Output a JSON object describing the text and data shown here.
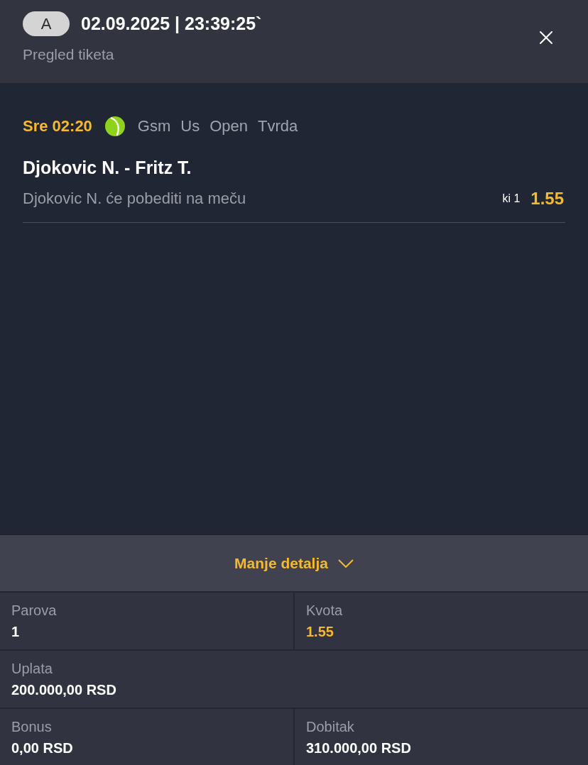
{
  "header": {
    "badge": "A",
    "datetime": "02.09.2025 | 23:39:25`",
    "subtitle": "Pregled tiketa"
  },
  "events": [
    {
      "time": "Sre 02:20",
      "kind": "tennis",
      "tags": [
        "Gsm",
        "Us",
        "Open",
        "Tvrda"
      ],
      "match": "Djokovic N. - Fritz T.",
      "selection": "Djokovic N. će pobediti na meču",
      "market": "ki 1",
      "odds": "1.55"
    }
  ],
  "details": {
    "toggle_label": "Manje detalja",
    "expanded": true,
    "rows": [
      [
        {
          "label": "Parova",
          "value": "1",
          "kind": "count"
        },
        {
          "label": "Kvota",
          "value": "1.55",
          "kind": "odds"
        }
      ],
      [
        {
          "label": "Uplata",
          "value": "200.000,00 RSD",
          "kind": "amount"
        }
      ],
      [
        {
          "label": "Bonus",
          "value": "0,00 RSD",
          "kind": "amount"
        },
        {
          "label": "Dobitak",
          "value": "310.000,00 RSD",
          "kind": "amount"
        }
      ]
    ]
  }
}
